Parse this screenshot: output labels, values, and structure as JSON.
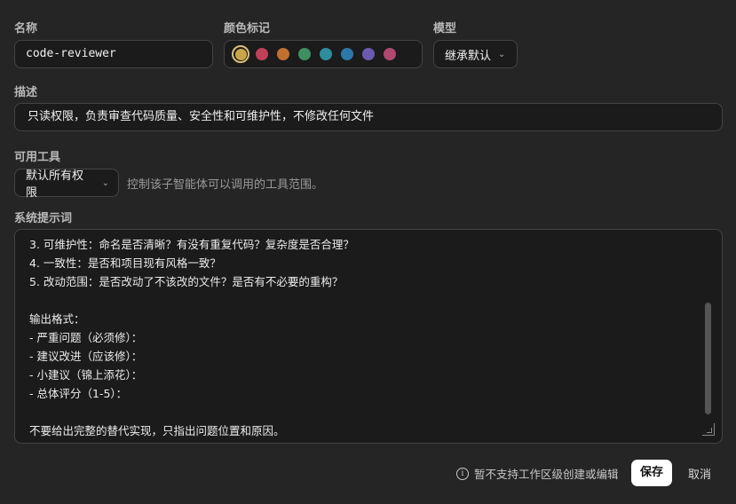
{
  "name": {
    "label": "名称",
    "value": "code-reviewer"
  },
  "color_tag": {
    "label": "颜色标记",
    "selected": "#c9a548",
    "swatches": [
      "#c9a548",
      "#c0405a",
      "#c2702e",
      "#3f8f62",
      "#2f8c9c",
      "#2c78a8",
      "#6b5bb0",
      "#b04870"
    ]
  },
  "model": {
    "label": "模型",
    "value": "继承默认"
  },
  "description": {
    "label": "描述",
    "value": "只读权限，负责审查代码质量、安全性和可维护性，不修改任何文件"
  },
  "tools": {
    "label": "可用工具",
    "value": "默认所有权限",
    "hint": "控制该子智能体可以调用的工具范围。"
  },
  "system_prompt": {
    "label": "系统提示词",
    "lines": [
      "3. 可维护性：命名是否清晰？有没有重复代码？复杂度是否合理？",
      "4. 一致性：是否和项目现有风格一致？",
      "5. 改动范围：是否改动了不该改的文件？是否有不必要的重构？",
      "",
      "输出格式：",
      "- 严重问题（必须修）：",
      "- 建议改进（应该修）：",
      "- 小建议（锦上添花）：",
      "- 总体评分（1-5）：",
      "",
      "不要给出完整的替代实现，只指出问题位置和原因。"
    ]
  },
  "footer": {
    "note": "暂不支持工作区级创建或编辑",
    "save_label": "保存",
    "cancel_label": "取消"
  }
}
